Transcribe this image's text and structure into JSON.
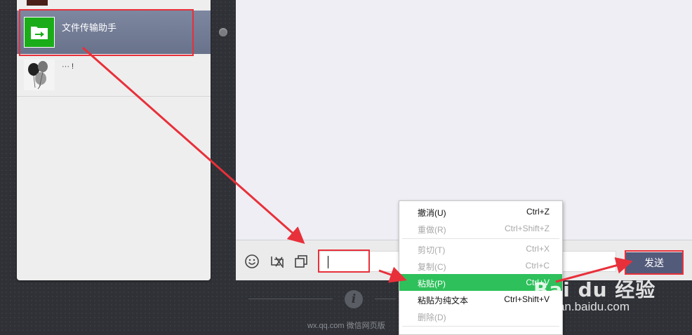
{
  "contacts": [
    {
      "name": "文件传输助手",
      "active": true
    },
    {
      "name": "··· !",
      "active": false
    }
  ],
  "input": {
    "value": ""
  },
  "send_label": "发送",
  "context_menu": [
    {
      "label": "撤消(U)",
      "shortcut": "Ctrl+Z",
      "disabled": false
    },
    {
      "label": "重做(R)",
      "shortcut": "Ctrl+Shift+Z",
      "disabled": true
    },
    {
      "label": "剪切(T)",
      "shortcut": "Ctrl+X",
      "disabled": true
    },
    {
      "label": "复制(C)",
      "shortcut": "Ctrl+C",
      "disabled": true
    },
    {
      "label": "粘贴(P)",
      "shortcut": "Ctrl+V",
      "disabled": false,
      "highlight": true
    },
    {
      "label": "粘贴为纯文本",
      "shortcut": "Ctrl+Shift+V",
      "disabled": false
    },
    {
      "label": "删除(D)",
      "shortcut": "",
      "disabled": true
    }
  ],
  "footer_text": "wx.qq.com 微信网页版",
  "watermark": {
    "brand": "Bai du 经验",
    "url": "jingyan.baidu.com"
  },
  "colors": {
    "accent_green": "#1aad19",
    "highlight_green": "#2ec05b",
    "send_button": "#535b7b",
    "annotation_red": "#e8303a"
  }
}
